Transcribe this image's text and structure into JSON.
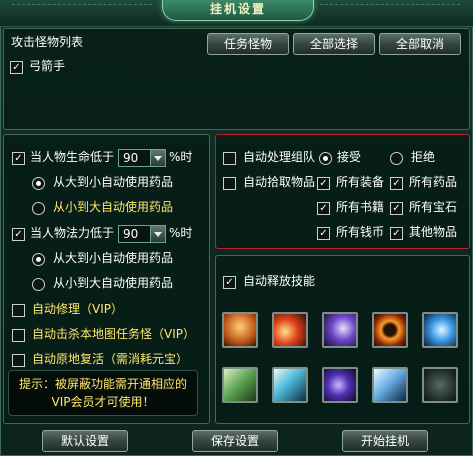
{
  "title": "挂机设置",
  "monster_panel": {
    "label": "攻击怪物列表",
    "buttons": [
      "任务怪物",
      "全部选择",
      "全部取消"
    ],
    "items": [
      {
        "label": "弓箭手",
        "checked": true
      }
    ]
  },
  "health": {
    "label": "当人物生命低于",
    "value": "90",
    "unit": "%时",
    "opt1": "从大到小自动使用药品",
    "opt2": "从小到大自动使用药品"
  },
  "mana": {
    "label": "当人物法力低于",
    "value": "90",
    "unit": "%时",
    "opt1": "从大到小自动使用药品",
    "opt2": "从小到大自动使用药品"
  },
  "vip_options": [
    "自动修理（VIP）",
    "自动击杀本地图任务怪（VIP）",
    "自动原地复活（需消耗元宝）"
  ],
  "hint": {
    "line1": "提示：被屏蔽功能需开通相应的",
    "line2": "VIP会员才可使用！"
  },
  "team": {
    "label": "自动处理组队",
    "accept": "接受",
    "refuse": "拒绝"
  },
  "pickup": {
    "label": "自动拾取物品",
    "items": [
      "所有装备",
      "所有药品",
      "所有书籍",
      "所有宝石",
      "所有钱币",
      "其他物品"
    ]
  },
  "skills": {
    "label": "自动释放技能",
    "icons": [
      "strength-skill-icon",
      "fire-slash-skill-icon",
      "shadow-claw-skill-icon",
      "fire-ring-skill-icon",
      "ice-strike-skill-icon",
      "shield-skill-icon",
      "lightning-skill-icon",
      "dark-orb-skill-icon",
      "ice-shards-skill-icon",
      "stone-guardian-skill-icon"
    ]
  },
  "footer": {
    "default": "默认设置",
    "save": "保存设置",
    "start": "开始挂机"
  },
  "colors": {
    "highlight_border": "#c0202a",
    "hint_text": "#ffe86a",
    "panel_border": "#3e6a58"
  }
}
